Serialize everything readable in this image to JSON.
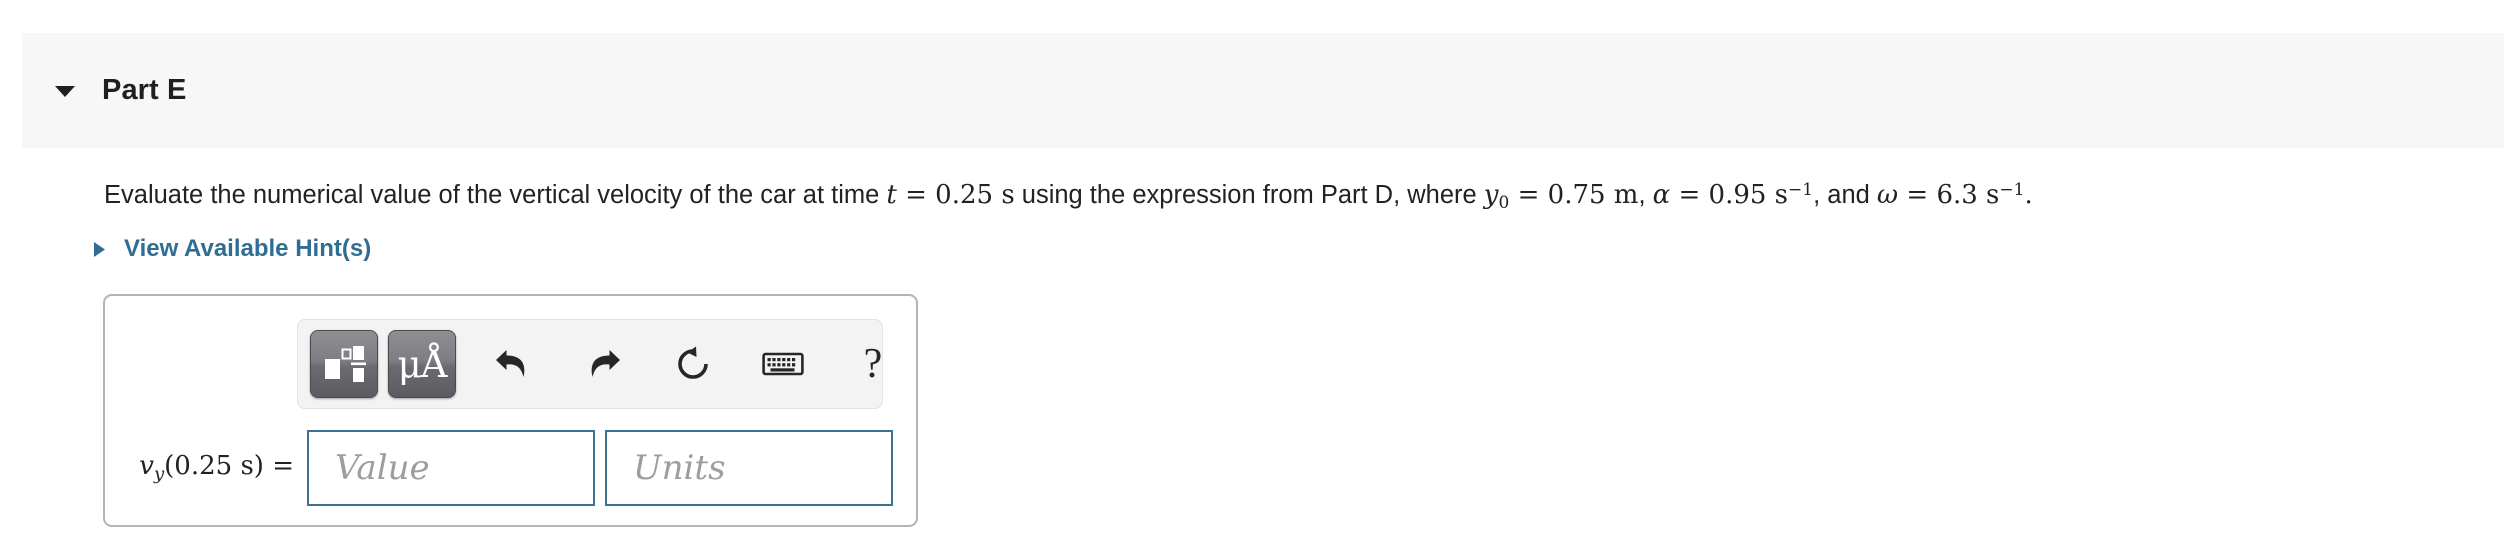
{
  "part_header": {
    "collapse_icon": "caret-down-icon",
    "title": "Part E"
  },
  "prompt": {
    "seg1": "Evaluate the numerical value of the vertical velocity of the car at time ",
    "t_var": "t",
    "eq1": " = ",
    "t_value": "0.25",
    "t_unit": " s",
    "seg2": " using the expression from Part D, where ",
    "y_var": "y",
    "y_sub": "0",
    "eq2": " = ",
    "y_value": "0.75",
    "y_unit": " m",
    "comma1": ", ",
    "alpha_var": "α",
    "eq3": " = ",
    "alpha_value": "0.95",
    "alpha_unit": " s",
    "alpha_exp": "−1",
    "comma2": ", and ",
    "omega_var": "ω",
    "eq4": " = ",
    "omega_value": "6.3",
    "omega_unit": " s",
    "omega_exp": "−1",
    "period": "."
  },
  "hints": {
    "caret_icon": "caret-right-icon",
    "label": "View Available Hint(s)"
  },
  "toolbar": {
    "template_button": {
      "icon": "math-template-icon",
      "tooltip": "Math templates"
    },
    "units_button": {
      "icon": "units-icon",
      "glyph": "μÅ",
      "tooltip": "Units"
    },
    "undo_button": {
      "icon": "undo-icon",
      "tooltip": "Undo"
    },
    "redo_button": {
      "icon": "redo-icon",
      "tooltip": "Redo"
    },
    "reset_button": {
      "icon": "reset-icon",
      "tooltip": "Reset"
    },
    "keyboard_button": {
      "icon": "keyboard-icon",
      "tooltip": "Keyboard shortcuts"
    },
    "help_button": {
      "icon": "help-icon",
      "glyph": "?",
      "tooltip": "Help"
    }
  },
  "answer": {
    "label_var": "v",
    "label_sub": "y",
    "label_rest": "(0.25 s) =",
    "value_placeholder": "Value",
    "units_placeholder": "Units",
    "value": "",
    "units": ""
  },
  "colors": {
    "header_bg": "#f7f7f7",
    "link_blue": "#2f6e92",
    "input_border": "#3d7292",
    "card_border": "#b4b4b4",
    "toolbar_bg": "#f3f3f3",
    "placeholder_gray": "#9d9d9d",
    "text": "#222222"
  }
}
